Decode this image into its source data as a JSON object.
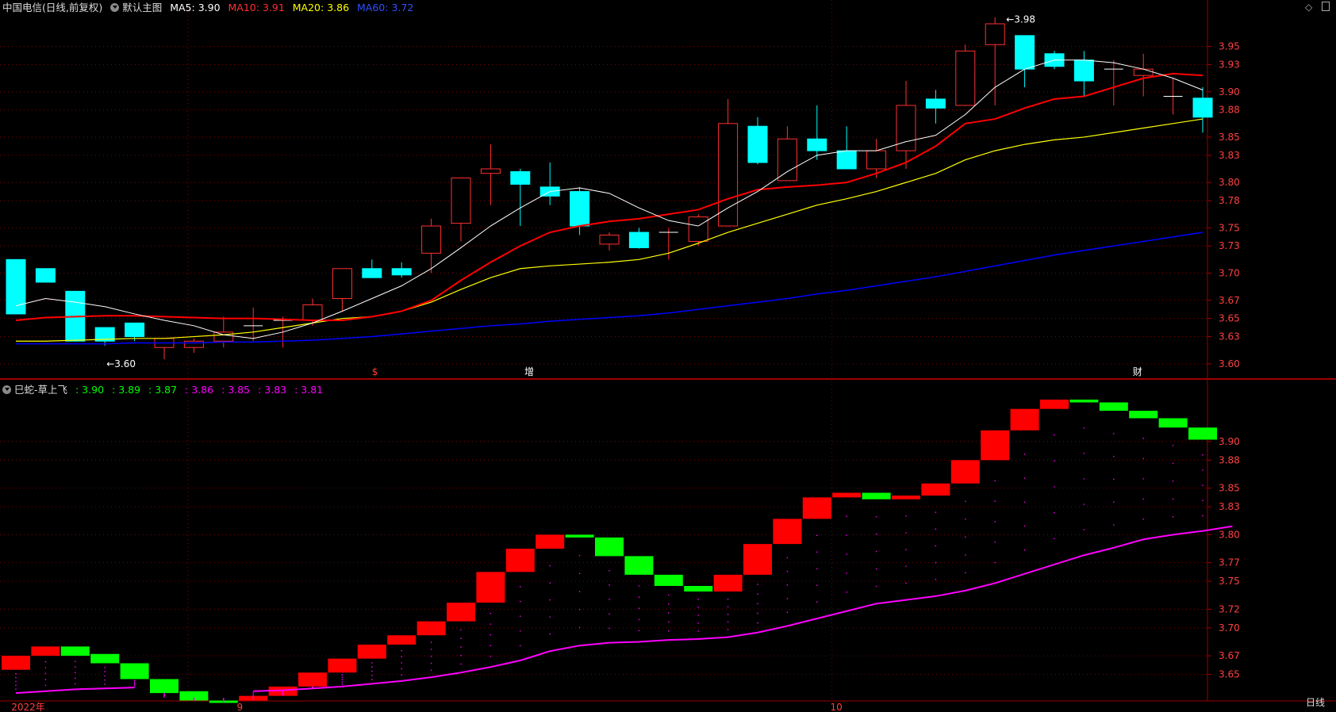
{
  "title": {
    "stock": "中国电信(日线,前复权)",
    "main_indicator": "默认主图",
    "ma5": "MA5: 3.90",
    "ma10": "MA10: 3.91",
    "ma20": "MA20: 3.86",
    "ma60": "MA60: 3.72"
  },
  "sub_title": {
    "name": "巳蛇-草上飞",
    "values": [
      ": 3.90",
      ": 3.89",
      ": 3.87",
      ": 3.86",
      ": 3.85",
      ": 3.83",
      ": 3.81"
    ]
  },
  "colors": {
    "up": "#ff3030",
    "down": "#00ffff",
    "ma5": "#ffffff",
    "ma10": "#ff0000",
    "ma20": "#ffff00",
    "ma60": "#0000ff",
    "grid": "#7a0000",
    "axis_text": "#ff4040",
    "sub_up": "#ff0000",
    "sub_down": "#00ff00",
    "sub_line": "#ff00ff"
  },
  "main_axis_labels": [
    "3.95",
    "3.93",
    "3.90",
    "3.88",
    "3.85",
    "3.83",
    "3.80",
    "3.78",
    "3.75",
    "3.73",
    "3.70",
    "3.67",
    "3.65",
    "3.63",
    "3.60"
  ],
  "sub_axis_labels": [
    "3.90",
    "3.88",
    "3.85",
    "3.83",
    "3.80",
    "3.77",
    "3.75",
    "3.72",
    "3.70",
    "3.67",
    "3.65"
  ],
  "markers": {
    "high": "3.98",
    "low": "3.60",
    "event1": "$",
    "event2": "增",
    "event3": "财"
  },
  "x_labels": {
    "year": "2022年",
    "m9": "9",
    "m10": "10"
  },
  "period": "日线",
  "chart_data": {
    "type": "candlestick",
    "ylim": [
      3.585,
      3.975
    ],
    "candles": [
      [
        3.715,
        3.715,
        3.655,
        3.655
      ],
      [
        3.705,
        3.705,
        3.69,
        3.69
      ],
      [
        3.68,
        3.68,
        3.625,
        3.625
      ],
      [
        3.64,
        3.64,
        3.62,
        3.625
      ],
      [
        3.645,
        3.645,
        3.625,
        3.63
      ],
      [
        3.618,
        3.628,
        3.605,
        3.628
      ],
      [
        3.618,
        3.628,
        3.612,
        3.625
      ],
      [
        3.625,
        3.652,
        3.618,
        3.635
      ],
      [
        3.642,
        3.662,
        3.625,
        3.642
      ],
      [
        3.648,
        3.652,
        3.618,
        3.648
      ],
      [
        3.648,
        3.672,
        3.642,
        3.665
      ],
      [
        3.672,
        3.705,
        3.658,
        3.705
      ],
      [
        3.705,
        3.715,
        3.695,
        3.695
      ],
      [
        3.705,
        3.712,
        3.695,
        3.698
      ],
      [
        3.722,
        3.76,
        3.7,
        3.752
      ],
      [
        3.755,
        3.805,
        3.735,
        3.805
      ],
      [
        3.81,
        3.842,
        3.775,
        3.815
      ],
      [
        3.812,
        3.815,
        3.752,
        3.798
      ],
      [
        3.795,
        3.822,
        3.775,
        3.785
      ],
      [
        3.79,
        3.795,
        3.742,
        3.752
      ],
      [
        3.732,
        3.745,
        3.725,
        3.742
      ],
      [
        3.745,
        3.75,
        3.727,
        3.728
      ],
      [
        3.745,
        3.75,
        3.715,
        3.745
      ],
      [
        3.735,
        3.765,
        3.73,
        3.762
      ],
      [
        3.752,
        3.892,
        3.752,
        3.865
      ],
      [
        3.862,
        3.872,
        3.82,
        3.822
      ],
      [
        3.802,
        3.862,
        3.802,
        3.848
      ],
      [
        3.848,
        3.885,
        3.825,
        3.835
      ],
      [
        3.835,
        3.862,
        3.815,
        3.815
      ],
      [
        3.815,
        3.848,
        3.805,
        3.835
      ],
      [
        3.835,
        3.912,
        3.815,
        3.885
      ],
      [
        3.892,
        3.902,
        3.865,
        3.882
      ],
      [
        3.885,
        3.952,
        3.885,
        3.945
      ],
      [
        3.952,
        3.982,
        3.885,
        3.975
      ],
      [
        3.962,
        3.962,
        3.905,
        3.925
      ],
      [
        3.942,
        3.945,
        3.925,
        3.928
      ],
      [
        3.935,
        3.945,
        3.895,
        3.912
      ],
      [
        3.925,
        3.935,
        3.885,
        3.925
      ],
      [
        3.918,
        3.942,
        3.895,
        3.925
      ],
      [
        3.895,
        3.915,
        3.875,
        3.895
      ],
      [
        3.893,
        3.905,
        3.855,
        3.872
      ]
    ],
    "ma5": [
      3.664,
      3.672,
      3.668,
      3.663,
      3.655,
      3.648,
      3.642,
      3.632,
      3.628,
      3.635,
      3.645,
      3.658,
      3.672,
      3.686,
      3.705,
      3.728,
      3.752,
      3.772,
      3.79,
      3.794,
      3.788,
      3.772,
      3.758,
      3.752,
      3.772,
      3.79,
      3.812,
      3.83,
      3.835,
      3.835,
      3.845,
      3.852,
      3.875,
      3.905,
      3.925,
      3.935,
      3.935,
      3.932,
      3.925,
      3.915,
      3.902
    ],
    "ma10": [
      3.648,
      3.651,
      3.652,
      3.653,
      3.653,
      3.652,
      3.651,
      3.65,
      3.65,
      3.649,
      3.648,
      3.648,
      3.652,
      3.658,
      3.67,
      3.692,
      3.712,
      3.73,
      3.745,
      3.752,
      3.757,
      3.76,
      3.765,
      3.77,
      3.782,
      3.792,
      3.795,
      3.797,
      3.8,
      3.81,
      3.822,
      3.84,
      3.865,
      3.87,
      3.882,
      3.892,
      3.895,
      3.905,
      3.915,
      3.92,
      3.918
    ],
    "ma20": [
      3.625,
      3.625,
      3.626,
      3.627,
      3.628,
      3.628,
      3.63,
      3.632,
      3.635,
      3.64,
      3.645,
      3.65,
      3.652,
      3.658,
      3.668,
      3.682,
      3.695,
      3.705,
      3.708,
      3.71,
      3.712,
      3.715,
      3.722,
      3.733,
      3.745,
      3.755,
      3.765,
      3.775,
      3.782,
      3.79,
      3.8,
      3.81,
      3.825,
      3.835,
      3.842,
      3.847,
      3.85,
      3.855,
      3.86,
      3.865,
      3.87
    ],
    "ma60": [
      3.622,
      3.622,
      3.622,
      3.622,
      3.623,
      3.623,
      3.623,
      3.624,
      3.624,
      3.625,
      3.626,
      3.628,
      3.63,
      3.633,
      3.636,
      3.639,
      3.642,
      3.644,
      3.647,
      3.649,
      3.651,
      3.653,
      3.656,
      3.66,
      3.664,
      3.668,
      3.672,
      3.677,
      3.681,
      3.686,
      3.691,
      3.696,
      3.702,
      3.708,
      3.714,
      3.72,
      3.725,
      3.73,
      3.735,
      3.74,
      3.745
    ],
    "sub_ylim": [
      3.625,
      3.945
    ],
    "sub_blocks": [
      [
        3.655,
        3.67,
        "u"
      ],
      [
        3.67,
        3.68,
        "u"
      ],
      [
        3.67,
        3.68,
        "d"
      ],
      [
        3.672,
        3.662,
        "d"
      ],
      [
        3.662,
        3.645,
        "d"
      ],
      [
        3.645,
        3.63,
        "d"
      ],
      [
        3.632,
        3.622,
        "d"
      ],
      [
        3.622,
        3.62,
        "d"
      ],
      [
        3.622,
        3.627,
        "u"
      ],
      [
        3.627,
        3.637,
        "u"
      ],
      [
        3.637,
        3.652,
        "u"
      ],
      [
        3.652,
        3.667,
        "u"
      ],
      [
        3.667,
        3.682,
        "u"
      ],
      [
        3.682,
        3.692,
        "u"
      ],
      [
        3.692,
        3.707,
        "u"
      ],
      [
        3.707,
        3.727,
        "u"
      ],
      [
        3.727,
        3.76,
        "u"
      ],
      [
        3.76,
        3.785,
        "u"
      ],
      [
        3.785,
        3.8,
        "u"
      ],
      [
        3.8,
        3.797,
        "d"
      ],
      [
        3.797,
        3.777,
        "d"
      ],
      [
        3.777,
        3.757,
        "d"
      ],
      [
        3.757,
        3.745,
        "d"
      ],
      [
        3.745,
        3.739,
        "d"
      ],
      [
        3.739,
        3.757,
        "u"
      ],
      [
        3.757,
        3.79,
        "u"
      ],
      [
        3.79,
        3.817,
        "u"
      ],
      [
        3.817,
        3.84,
        "u"
      ],
      [
        3.84,
        3.845,
        "u"
      ],
      [
        3.845,
        3.838,
        "d"
      ],
      [
        3.838,
        3.842,
        "u"
      ],
      [
        3.842,
        3.855,
        "u"
      ],
      [
        3.855,
        3.88,
        "u"
      ],
      [
        3.88,
        3.912,
        "u"
      ],
      [
        3.912,
        3.935,
        "u"
      ],
      [
        3.935,
        3.945,
        "u"
      ],
      [
        3.945,
        3.942,
        "d"
      ],
      [
        3.942,
        3.933,
        "d"
      ],
      [
        3.933,
        3.925,
        "d"
      ],
      [
        3.925,
        3.915,
        "d"
      ],
      [
        3.915,
        3.902,
        "d"
      ]
    ],
    "sub_line": [
      3.63,
      3.632,
      3.634,
      3.635,
      3.636,
      null,
      null,
      null,
      3.632,
      3.633,
      3.635,
      3.637,
      3.64,
      3.643,
      3.647,
      3.652,
      3.658,
      3.665,
      3.675,
      3.681,
      3.684,
      3.685,
      3.687,
      3.688,
      3.69,
      3.695,
      3.702,
      3.71,
      3.718,
      3.726,
      3.73,
      3.734,
      3.74,
      3.748,
      3.758,
      3.768,
      3.778,
      3.786,
      3.795,
      3.8,
      3.804,
      3.809
    ]
  }
}
